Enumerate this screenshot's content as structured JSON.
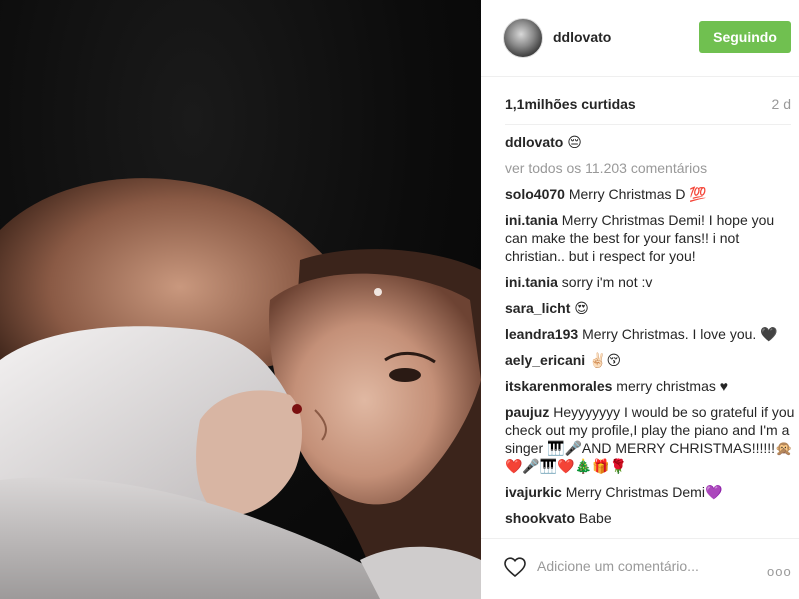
{
  "post": {
    "owner": "ddlovato",
    "follow_label": "Seguindo",
    "likes_text": "1,1milhões curtidas",
    "time_ago": "2 d"
  },
  "caption": {
    "user": "ddlovato",
    "emoji": "😔"
  },
  "view_all": "ver todos os 11.203 comentários",
  "comments": [
    {
      "user": "solo4070",
      "text": "Merry Christmas D 💯"
    },
    {
      "user": "ini.tania",
      "text": "Merry Christmas Demi! I hope you can make the best for your fans!! i not christian.. but i respect for you!"
    },
    {
      "user": "ini.tania",
      "text": "sorry i'm not :v"
    },
    {
      "user": "sara_licht",
      "text": "😍"
    },
    {
      "user": "leandra193",
      "text": "Merry Christmas. I love you. 🖤"
    },
    {
      "user": "aely_ericani",
      "text": "✌🏻😚"
    },
    {
      "user": "itskarenmorales",
      "text": "merry christmas ♥"
    },
    {
      "user": "paujuz",
      "text": "Heyyyyyyy I would be so grateful if you check out my profile,I play the piano and I'm a singer 🎹🎤AND MERRY CHRISTMAS!!!!!!🙊❤️🎤🎹❤️🎄🎁🌹"
    },
    {
      "user": "ivajurkic",
      "text": "Merry Christmas Demi💜"
    },
    {
      "user": "shookvato",
      "text": "Babe"
    }
  ],
  "footer": {
    "comment_placeholder": "Adicione um comentário...",
    "more": "ooo"
  },
  "icons": {
    "like": "heart-outline-icon",
    "more": "more-options-icon"
  },
  "colors": {
    "follow_button": "#70c050",
    "muted_text": "#999999"
  }
}
